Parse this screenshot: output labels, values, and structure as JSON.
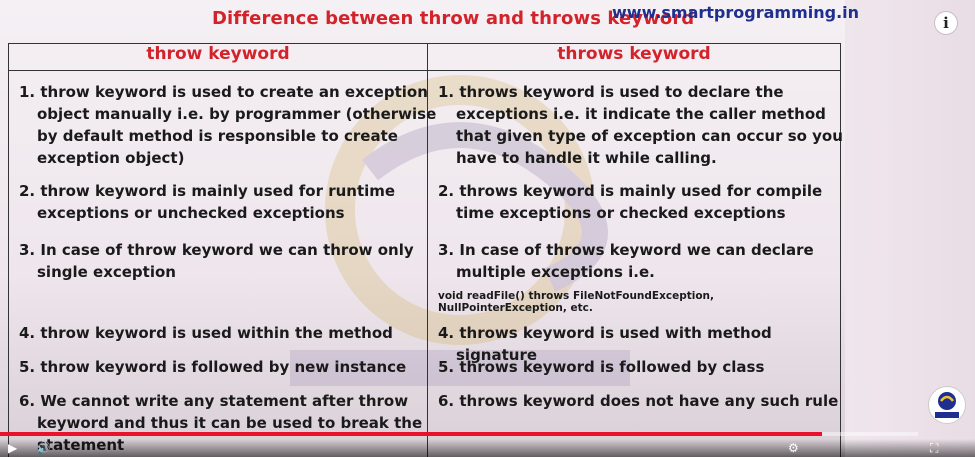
{
  "header": {
    "title": "Difference between throw and throws keyword",
    "site": "www.smartprogramming.in"
  },
  "columns": {
    "left_heading": "throw keyword",
    "right_heading": "throws keyword"
  },
  "left_points": [
    "1. throw keyword is used to create an exception object manually i.e. by programmer (otherwise by default method is responsible to create exception object)",
    "2. throw keyword is mainly used for runtime exceptions or unchecked exceptions",
    "3. In case of throw keyword we can throw only single exception",
    "4. throw keyword is used within the method",
    "5. throw keyword is followed by new instance",
    "6. We cannot write any statement after throw keyword and thus it can be used to break the statement"
  ],
  "right_points": [
    "1. throws keyword is used to declare the exceptions i.e. it indicate the caller method that given type of exception can occur so you have to handle it while calling.",
    "2. throws keyword is mainly used for compile time exceptions or checked exceptions",
    "3. In case of throws keyword we can declare multiple exceptions i.e.",
    "4. throws keyword is used with method signature",
    "5. throws keyword is followed by class",
    "6. throws keyword does not have any such rule"
  ],
  "code_example": "void readFile() throws FileNotFoundException, NullPointerException, etc.",
  "player": {
    "info_icon": "i",
    "progress": 0.895,
    "accent": "#e8122a"
  },
  "colors": {
    "title": "#d2232a",
    "site": "#1e2f8f",
    "text": "#1a1a1a"
  }
}
